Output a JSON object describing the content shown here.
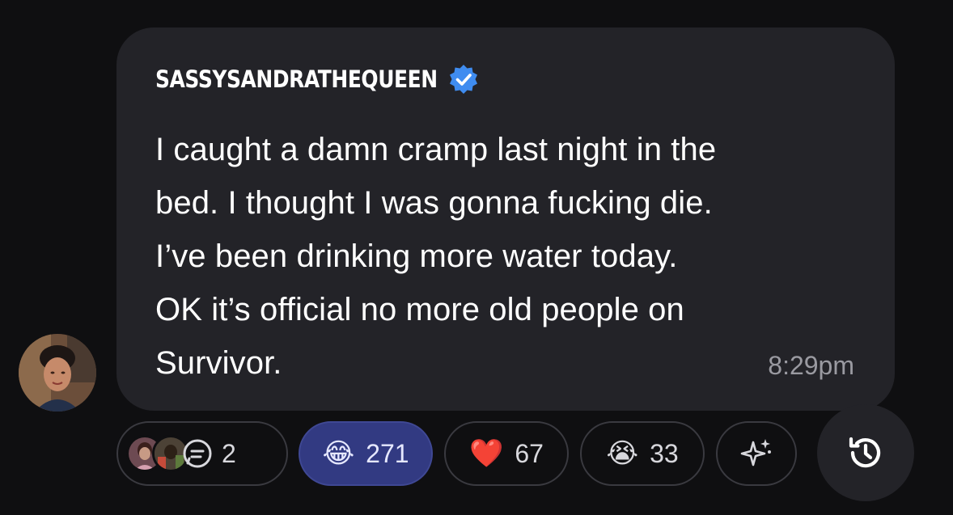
{
  "post": {
    "author": "SASSYSANDRATHEQUEEN",
    "verified": true,
    "message": "I caught a damn cramp last night in the bed. I thought I was gonna fucking die. I’ve been drinking more water today. OK it’s official no more old people on Survivor.",
    "message_lines": [
      "I caught a damn cramp last night in the",
      "bed. I thought I was gonna fucking die.",
      "I’ve been drinking more water today.",
      "OK it’s official no more old people on",
      "Survivor."
    ],
    "time": "8:29pm"
  },
  "reactions": {
    "replies": {
      "count": "2",
      "icon": "comment-icon"
    },
    "laugh": {
      "emoji": "😂",
      "count": "271",
      "active": true
    },
    "heart": {
      "emoji": "❤️",
      "count": "67"
    },
    "cry": {
      "emoji": "😭",
      "count": "33"
    },
    "ai": {
      "icon": "sparkles-icon"
    },
    "history": {
      "icon": "history-icon"
    }
  },
  "colors": {
    "background": "#0f0f11",
    "bubble": "#232328",
    "active_pill": "#323a82",
    "verified_blue": "#3f8cf0",
    "muted_text": "#9a9aa1"
  }
}
